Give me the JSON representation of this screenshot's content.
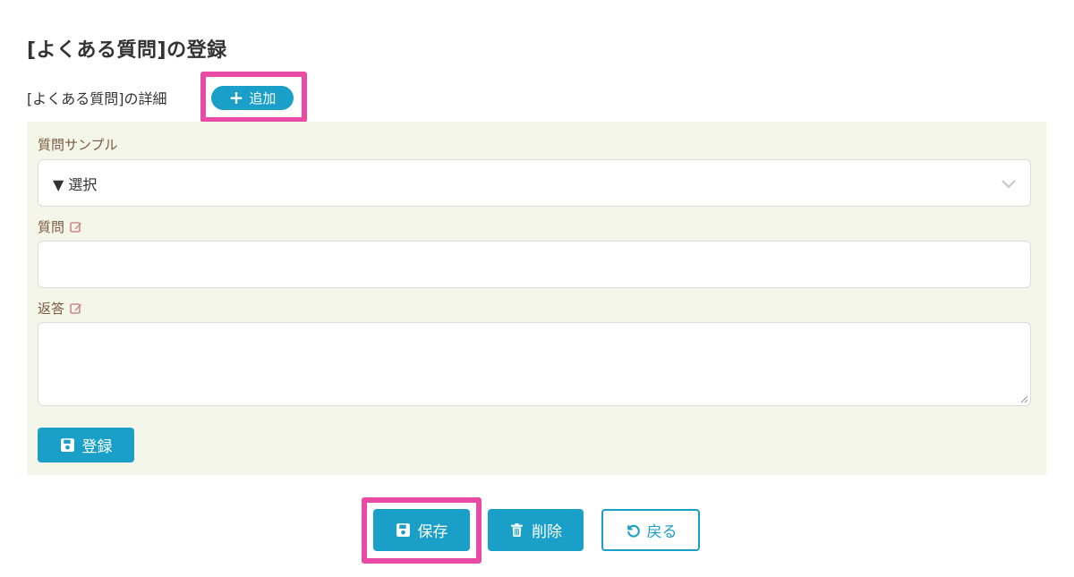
{
  "page": {
    "title": "[よくある質問]の登録"
  },
  "detail": {
    "label": "[よくある質問]の詳細",
    "add_label": "追加"
  },
  "form": {
    "sample_label": "質問サンプル",
    "sample_value": "▼ 選択",
    "question_label": "質問",
    "question_value": "",
    "answer_label": "返答",
    "answer_value": "",
    "register_label": "登録"
  },
  "actions": {
    "save_label": "保存",
    "delete_label": "削除",
    "back_label": "戻る"
  },
  "colors": {
    "accent": "#1a9fc9",
    "highlight": "#e84aa5",
    "panel_bg": "#f4f6ea",
    "label_text": "#7a5a3e"
  },
  "icons": {
    "add": "plus-icon",
    "edit": "edit-icon",
    "save": "floppy-disk-icon",
    "delete": "trash-icon",
    "back": "undo-icon",
    "dropdown": "chevron-down-icon"
  }
}
